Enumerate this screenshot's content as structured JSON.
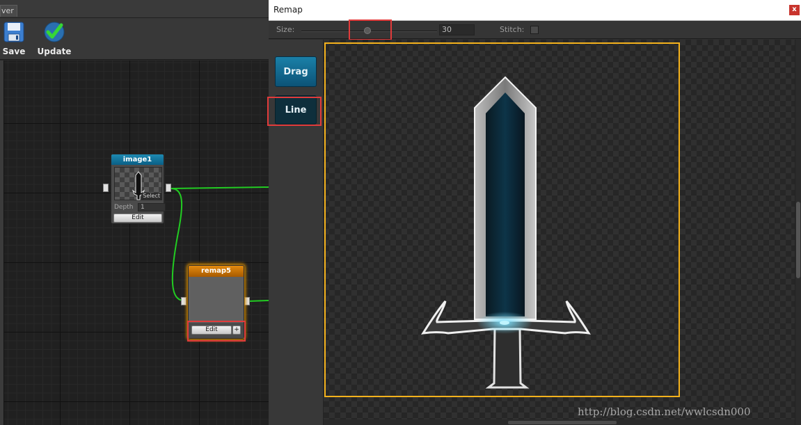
{
  "editor": {
    "tab_label": "ver",
    "toolbar": {
      "save_label": "Save",
      "update_label": "Update"
    },
    "nodes": {
      "image1": {
        "title": "image1",
        "select_badge": "Select",
        "depth_label": "Depth",
        "depth_value": "1",
        "edit_label": "Edit"
      },
      "remap5": {
        "title": "remap5",
        "edit_label": "Edit",
        "add_label": "+"
      }
    }
  },
  "remap_window": {
    "title": "Remap",
    "close_label": "x",
    "options": {
      "size_label": "Size:",
      "size_value": "30",
      "size_slider_fraction": 0.5,
      "stitch_label": "Stitch:",
      "stitch_checked": false
    },
    "modes": {
      "drag_label": "Drag",
      "line_label": "Line",
      "active": "Line"
    },
    "frame_color": "#f5b21c"
  },
  "colors": {
    "accent_blue": "#1a80a8",
    "node_orange": "#e38a10",
    "wire_green": "#22cc22",
    "highlight_red": "#e23b3b"
  },
  "watermark": "http://blog.csdn.net/wwlcsdn000"
}
